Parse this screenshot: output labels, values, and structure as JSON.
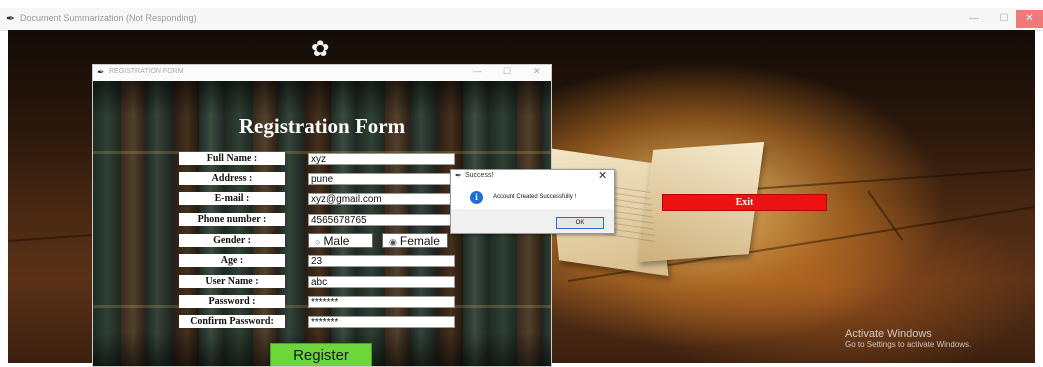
{
  "main_window": {
    "title": "Document Summarization (Not Responding)",
    "exit_label": "Exit",
    "activate_title": "Activate Windows",
    "activate_subtitle": "Go to Settings to activate Windows."
  },
  "registration_window": {
    "title": "REGISTRATION FORM",
    "heading": "Registration Form",
    "fields": [
      {
        "label": "Full Name :",
        "value": "xyz"
      },
      {
        "label": "Address :",
        "value": "pune"
      },
      {
        "label": "E-mail :",
        "value": "xyz@gmail.com"
      },
      {
        "label": "Phone number :",
        "value": "4565678765"
      },
      {
        "label": "Gender :",
        "value": ""
      },
      {
        "label": "Age :",
        "value": "23"
      },
      {
        "label": "User Name :",
        "value": "abc"
      },
      {
        "label": "Password :",
        "value": "*******"
      },
      {
        "label": "Confirm Password:",
        "value": "*******"
      }
    ],
    "gender": {
      "male_label": "Male",
      "female_label": "Female",
      "selected": "Female"
    },
    "register_label": "Register"
  },
  "dialog": {
    "title": "Success!",
    "message": "Account Created Successfully !",
    "ok_label": "OK",
    "icon": "info-icon"
  },
  "colors": {
    "exit_button": "#ee1111",
    "register_button": "#6cd63a",
    "info_icon": "#1f6fd6"
  }
}
